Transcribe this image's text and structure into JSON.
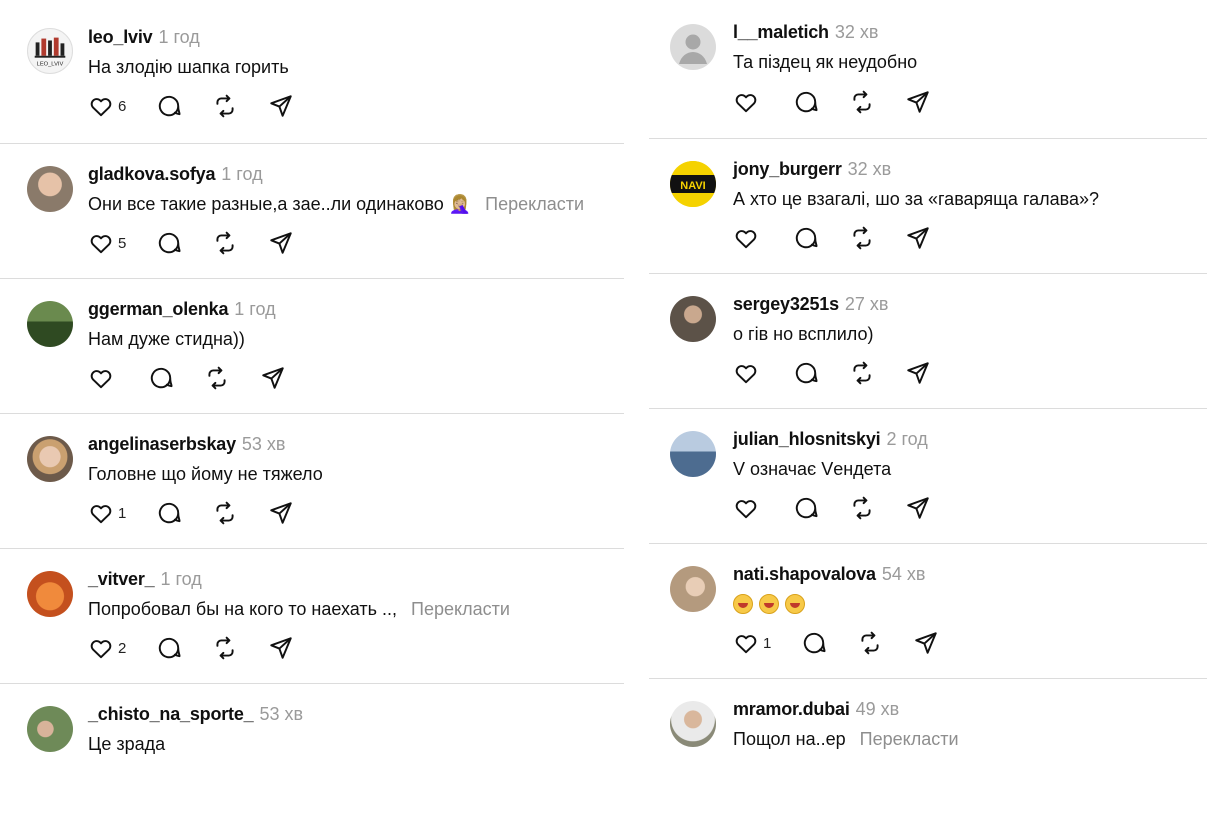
{
  "left_column": [
    {
      "username": "leo_lviv",
      "time": "1 год",
      "text": "На злодію шапка горить",
      "translate": "",
      "likes": "6",
      "avatar_kind": "logo",
      "avatar_text": "LEO_LVIV",
      "avatar_color": "#f4f4f4"
    },
    {
      "username": "gladkova.sofya",
      "time": "1 год",
      "text": "Они все такие разные,а зае..ли одинаково 🤦🏼‍♀️",
      "translate": "Перекласти",
      "likes": "5",
      "avatar_kind": "photo",
      "avatar_color": "#8a7a6a"
    },
    {
      "username": "ggerman_olenka",
      "time": "1 год",
      "text": "Нам дуже стидна))",
      "translate": "",
      "likes": "",
      "avatar_kind": "photo",
      "avatar_color": "#3e5a2c"
    },
    {
      "username": "angelinaserbskay",
      "time": "53 хв",
      "text": "Головне що йому не тяжело",
      "translate": "",
      "likes": "1",
      "avatar_kind": "photo",
      "avatar_color": "#6d5a4a"
    },
    {
      "username": "_vitver_",
      "time": "1 год",
      "text": "Попробовал бы на кого то наехать ..,",
      "translate": "Перекласти",
      "likes": "2",
      "avatar_kind": "photo",
      "avatar_color": "#e06a28"
    },
    {
      "username": "_chisto_na_sporte_",
      "time": "53 хв",
      "text": "Це зрада",
      "translate": "",
      "likes": "",
      "avatar_kind": "photo",
      "avatar_color": "#6e8a58"
    }
  ],
  "right_column": [
    {
      "username": "l__maletich",
      "time": "32 хв",
      "text": "Та пізде‌ц як неудобно",
      "translate": "",
      "likes": "",
      "avatar_kind": "default",
      "avatar_color": "#dbdbdb"
    },
    {
      "username": "jony_burgerr",
      "time": "32 хв",
      "text": "А хто це взагалі, шо за «гаваряща галава»?",
      "translate": "",
      "likes": "",
      "avatar_kind": "logo",
      "avatar_text": "NAVI",
      "avatar_color": "#f5d200"
    },
    {
      "username": "sergey3251s",
      "time": "27 хв",
      "text": "о гів но всплило)",
      "translate": "",
      "likes": "",
      "avatar_kind": "photo",
      "avatar_color": "#5c5248"
    },
    {
      "username": "julian_hlosnitskyi",
      "time": "2 год",
      "text": "V означає Vендета",
      "translate": "",
      "likes": "",
      "avatar_kind": "photo",
      "avatar_color": "#4d6c90"
    },
    {
      "username": "nati.shapovalova",
      "time": "54 хв",
      "text": "",
      "emojis": [
        "😆",
        "😆",
        "😆"
      ],
      "translate": "",
      "likes": "1",
      "avatar_kind": "photo",
      "avatar_color": "#b49a7e"
    },
    {
      "username": "mramor.dubai",
      "time": "49 хв",
      "text": "Пощол на..ер",
      "translate": "Перекласти",
      "likes": "",
      "avatar_kind": "photo",
      "avatar_color": "#8a8a78"
    }
  ],
  "icons": {
    "like": "heart-icon",
    "reply": "comment-icon",
    "repost": "repost-icon",
    "share": "share-icon"
  }
}
